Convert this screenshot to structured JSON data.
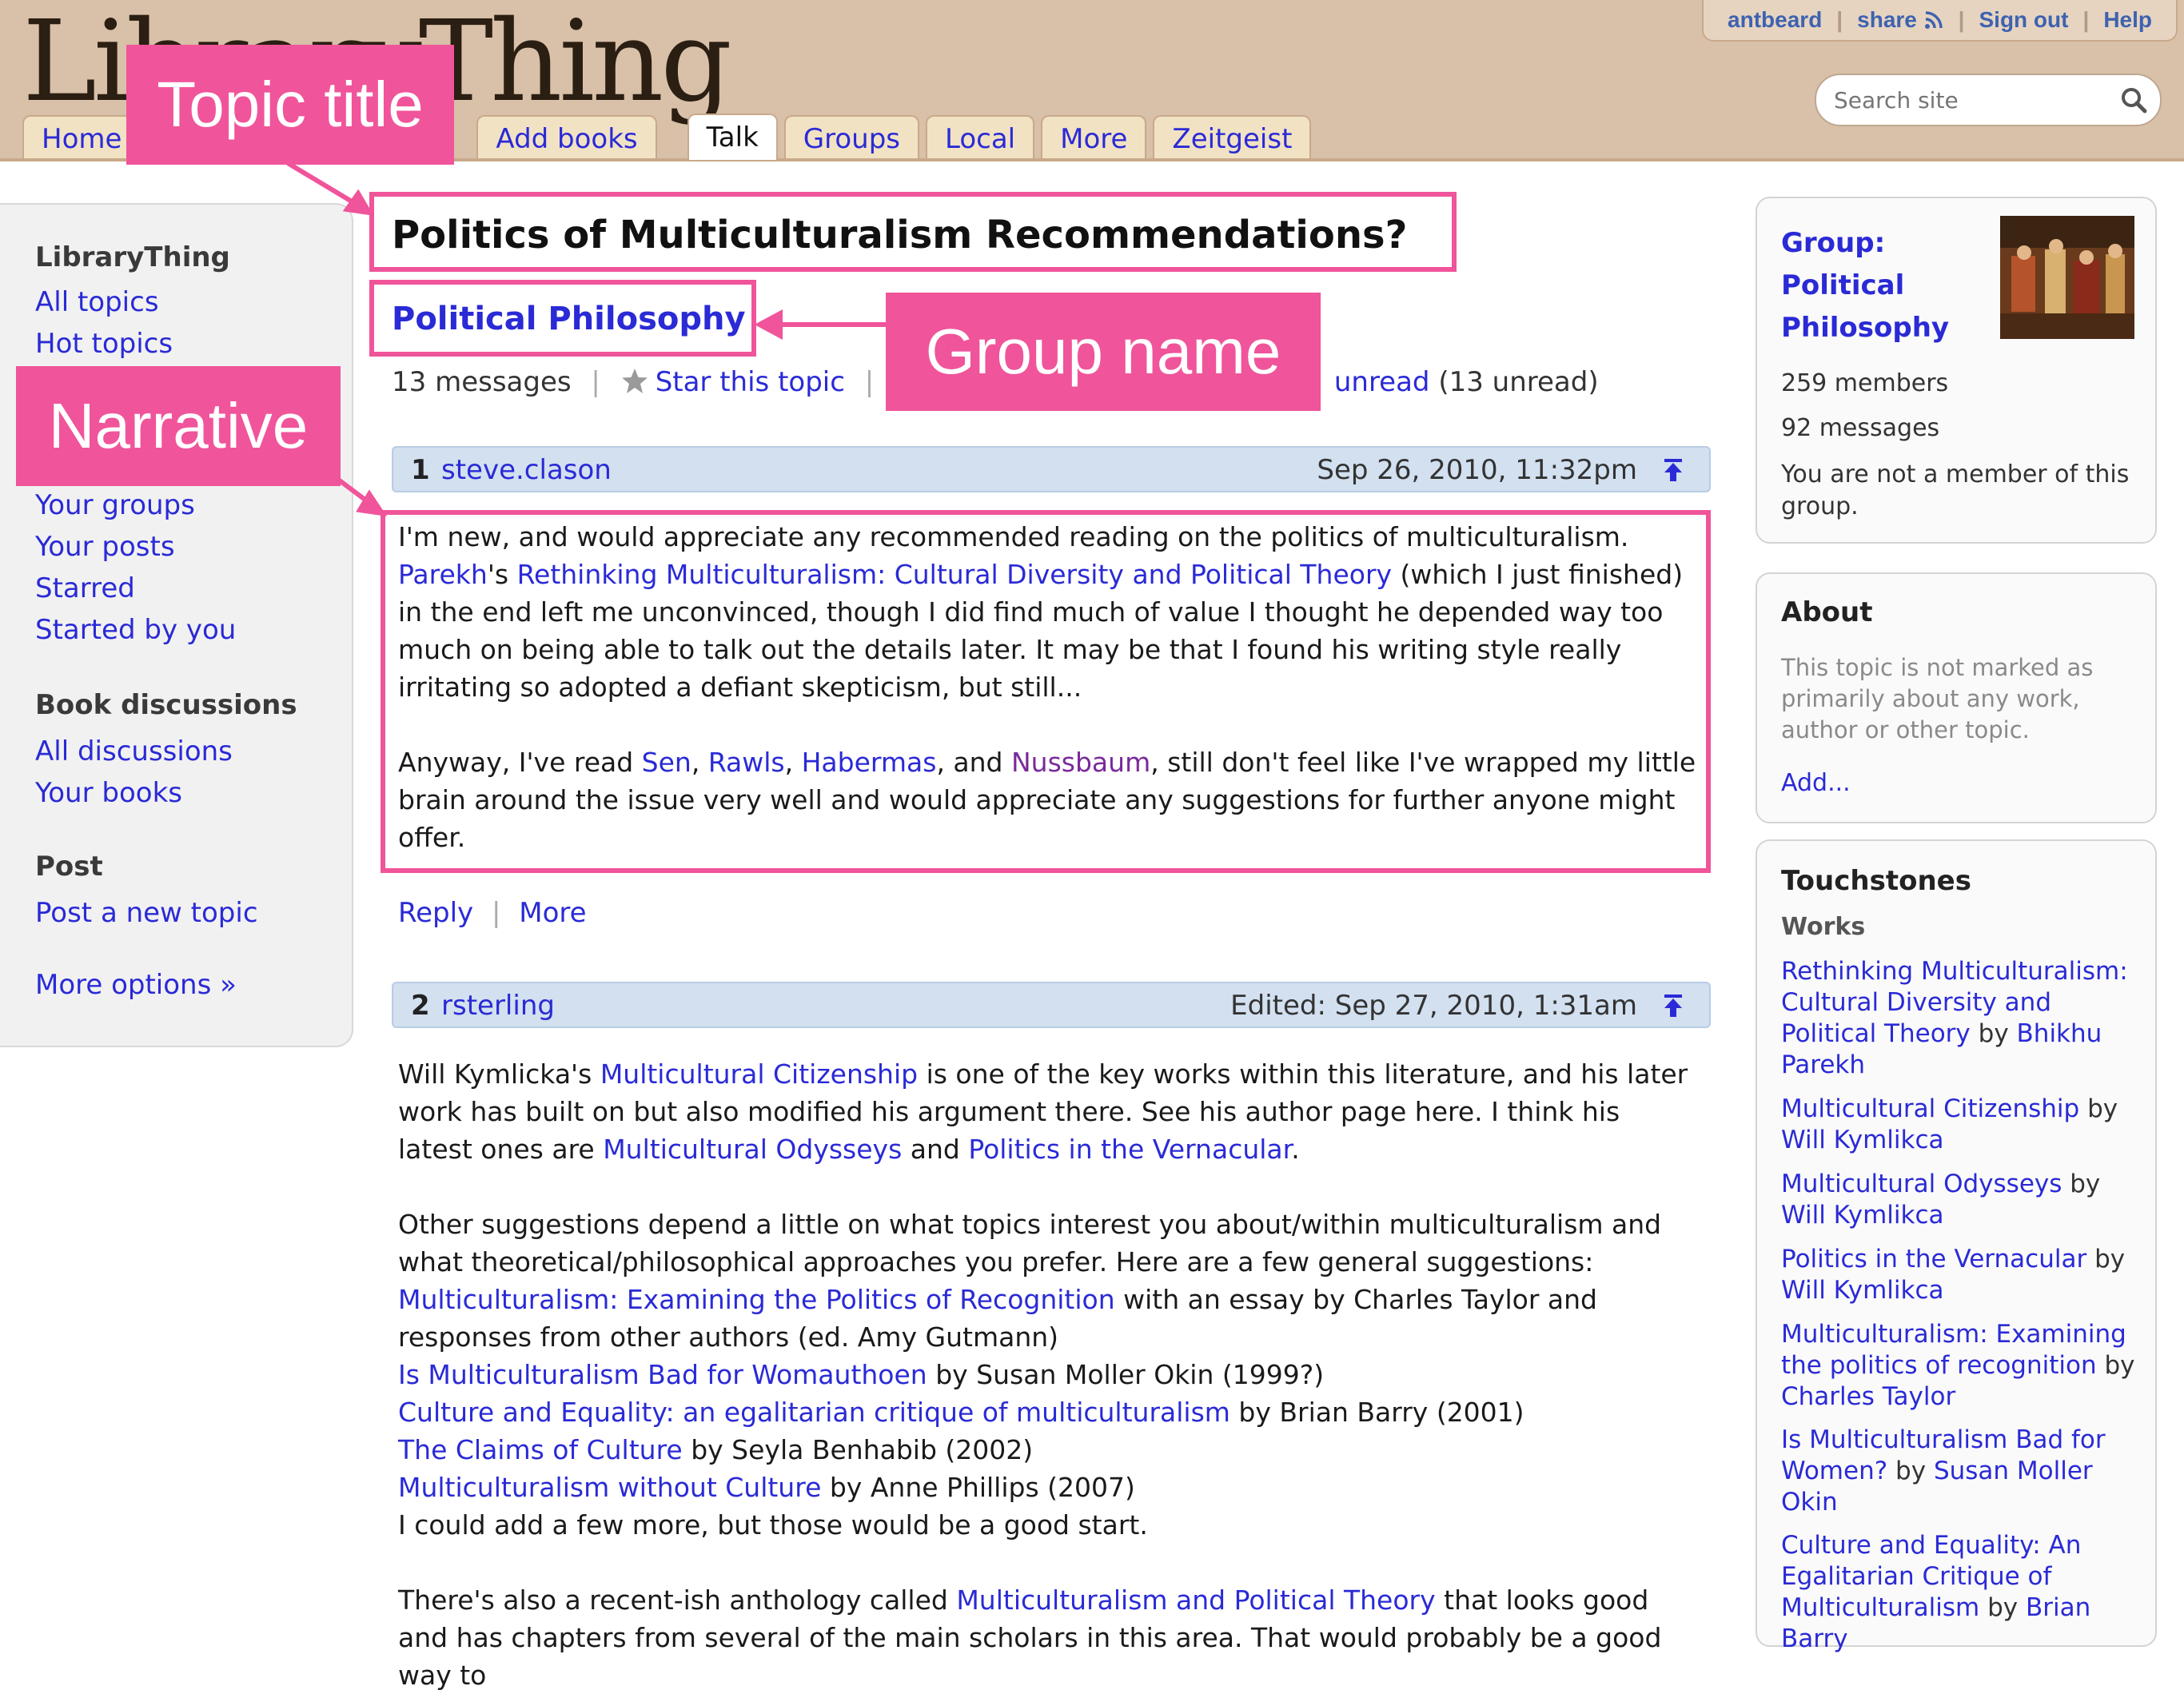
{
  "header": {
    "logo_text": "LibraryThing",
    "topbar": {
      "user": "antbeard",
      "share": "share",
      "sign_out": "Sign out",
      "help": "Help"
    },
    "search": {
      "placeholder": "Search site"
    },
    "tabs": [
      {
        "label": "Home"
      },
      {
        "label": "Add books"
      },
      {
        "label": "Talk"
      },
      {
        "label": "Groups"
      },
      {
        "label": "Local"
      },
      {
        "label": "More"
      },
      {
        "label": "Zeitgeist"
      }
    ]
  },
  "sidebar": {
    "section1_title": "LibraryThing",
    "links1": [
      "All topics",
      "Hot topics",
      "Your groups",
      "Your posts",
      "Starred",
      "Started by you"
    ],
    "section2_title": "Book discussions",
    "links2": [
      "All discussions",
      "Your books"
    ],
    "section3_title": "Post",
    "links3": [
      "Post a new topic"
    ],
    "more_options": "More options »"
  },
  "topic": {
    "title": "Politics of Multiculturalism Recommendations?",
    "group": "Political Philosophy",
    "message_count": "13 messages",
    "star_label": "Star this topic",
    "unread_link": "unread",
    "unread_count": "(13 unread)"
  },
  "messages": [
    {
      "num": "1",
      "author": "steve.clason",
      "date": "Sep 26, 2010, 11:32pm",
      "p1": {
        "line1": "I'm new, and would appreciate any recommended reading on the politics of multiculturalism.",
        "link_author": "Parekh",
        "possessive": "'s",
        "link_book": "Rethinking Multiculturalism: Cultural Diversity and Political Theory",
        "rest": " (which I just finished) in the end left me unconvinced, though I did find much of value I thought he depended way too much on being able to talk out the details later. It may be that I found his writing style really irritating so adopted a defiant skepticism, but still..."
      },
      "p2": {
        "start": "Anyway, I've read ",
        "l1": "Sen",
        "l2": "Rawls",
        "l3": "Habermas",
        "and": ", and ",
        "l4": "Nussbaum",
        "rest": ", still don't feel like I've wrapped my little brain around the issue very well and would appreciate any suggestions for further anyone might offer."
      },
      "actions": {
        "reply": "Reply",
        "more": "More"
      }
    },
    {
      "num": "2",
      "author": "rsterling",
      "date": "Edited: Sep 27, 2010, 1:31am",
      "p1": {
        "start": "Will Kymlicka's ",
        "l1": "Multicultural Citizenship",
        "mid": " is one of the key works within this literature, and his later work has built on but also modified his argument there. See his author page here. I think his latest ones are ",
        "l2": "Multicultural Odysseys",
        "and": " and ",
        "l3": "Politics in the Vernacular",
        "end": "."
      },
      "p2": {
        "intro": "Other suggestions depend a little on what topics interest you about/within multiculturalism and what theoretical/philosophical approaches you prefer. Here are a few general suggestions:",
        "items": [
          {
            "link": "Multiculturalism: Examining the Politics of Recognition",
            "text": " with an essay by Charles Taylor and responses from other authors (ed. Amy Gutmann)"
          },
          {
            "link": "Is Multiculturalism Bad for Womauthoen",
            "text": " by Susan Moller Okin (1999?)"
          },
          {
            "link": "Culture and Equality: an egalitarian critique of multiculturalism",
            "text": " by Brian Barry (2001)"
          },
          {
            "link": "The Claims of Culture",
            "text": " by Seyla Benhabib (2002)"
          },
          {
            "link": "Multiculturalism without Culture",
            "text": " by Anne Phillips (2007)"
          }
        ],
        "closing": "I could add a few more, but those would be a good start."
      },
      "p3": {
        "start": "There's also a recent-ish anthology called ",
        "link": "Multiculturalism and Political Theory",
        "end": " that looks good and has chapters from several of the main scholars in this area. That would probably be a good way to"
      }
    }
  ],
  "right": {
    "group_box": {
      "title_line1": "Group:",
      "title_line2": "Political",
      "title_line3": "Philosophy",
      "members": "259 members",
      "messages": "92 messages",
      "membership": "You are not a member of this group."
    },
    "about_box": {
      "title": "About",
      "text": "This topic is not marked as primarily about any work, author or other topic.",
      "add": "Add..."
    },
    "touchstones": {
      "title": "Touchstones",
      "works_label": "Works",
      "by": "by",
      "items": [
        {
          "title": "Rethinking Multiculturalism: Cultural Diversity and Political Theory",
          "author": "Bhikhu Parekh"
        },
        {
          "title": "Multicultural Citizenship",
          "author": "Will Kymlikca"
        },
        {
          "title": "Multicultural Odysseys",
          "author": "Will Kymlikca"
        },
        {
          "title": "Politics in the Vernacular",
          "author": "Will Kymlikca"
        },
        {
          "title": "Multiculturalism: Examining the politics of recognition",
          "author": "Charles Taylor"
        },
        {
          "title": "Is Multiculturalism Bad for Women?",
          "author": "Susan Moller Okin"
        },
        {
          "title": "Culture and Equality: An Egalitarian Critique of Multiculturalism",
          "author": "Brian Barry"
        }
      ]
    }
  },
  "annotations": {
    "topic_title": "Topic title",
    "group_name": "Group name",
    "narrative": "Narrative",
    "color": "#f0549a"
  },
  "colors": {
    "header_bg": "#d9c0a8",
    "link": "#2a2ad6",
    "visited_link": "#7a2a9a",
    "message_bar": "#d2e0f0",
    "callout": "#f0549a"
  }
}
